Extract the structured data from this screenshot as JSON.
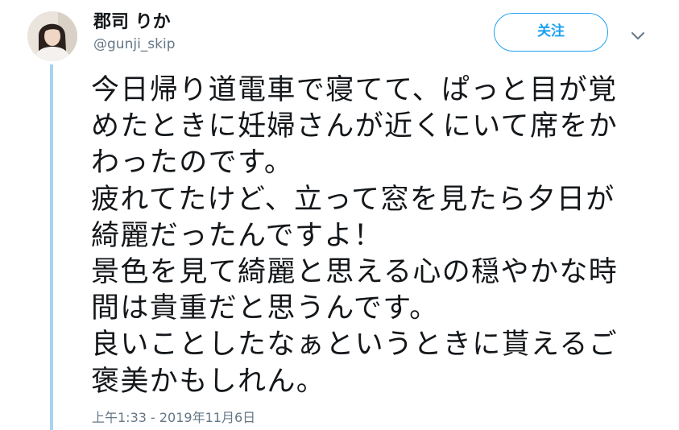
{
  "user": {
    "display_name": "郡司 りか",
    "handle": "@gunji_skip"
  },
  "follow_button": {
    "label": "关注"
  },
  "menu": {
    "icon": "chevron-down-icon"
  },
  "tweet": {
    "lines": [
      "今日帰り道電車で寝てて、ぱっと目が覚",
      "めたときに妊婦さんが近くにいて席をか",
      "わったのです。",
      "疲れてたけど、立って窓を見たら夕日が",
      "綺麗だったんですよ！",
      "景色を見て綺麗と思える心の穏やかな時",
      "間は貴重だと思うんです。",
      "良いことしたなぁというときに貰えるご",
      "褒美かもしれん。"
    ],
    "timestamp": "上午1:33 - 2019年11月6日"
  },
  "colors": {
    "accent": "#1da1f2",
    "thread_line": "#a6d4f0",
    "secondary_text": "#657786",
    "primary_text": "#14171a"
  }
}
